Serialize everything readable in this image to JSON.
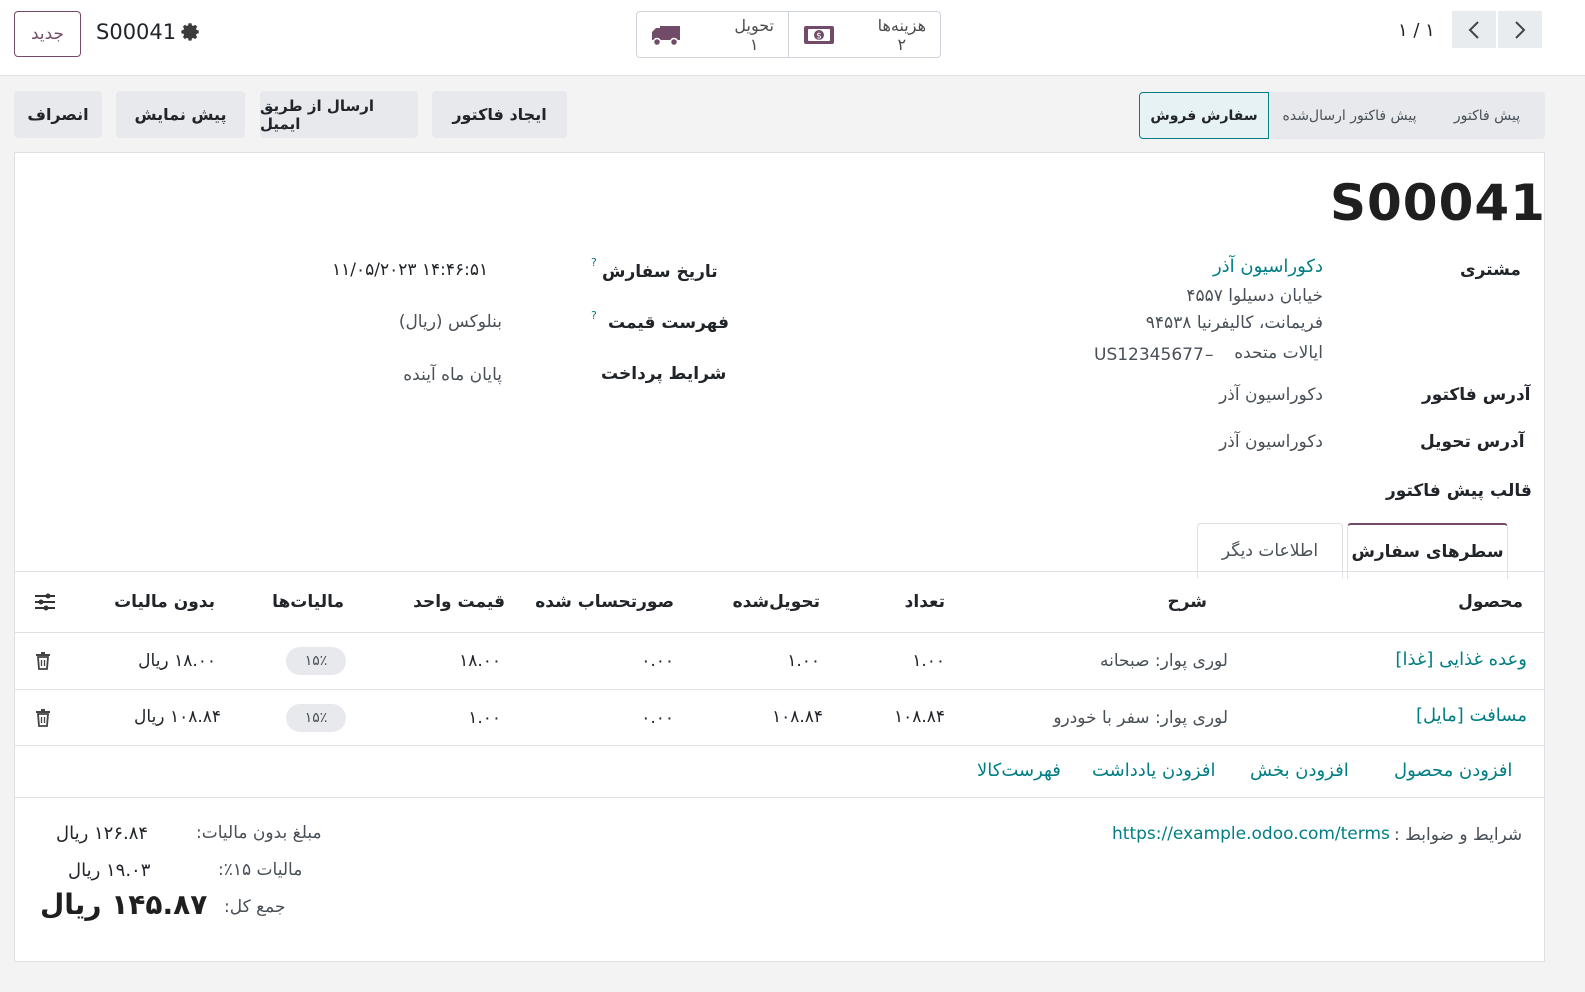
{
  "topbar": {
    "new_label": "جدید",
    "record_name": "S00041",
    "smart_buttons": [
      {
        "label": "هزینه‌ها",
        "count": "۲",
        "icon": "money-icon"
      },
      {
        "label": "تحویل",
        "count": "۱",
        "icon": "truck-icon"
      }
    ],
    "pager": "۱ / ۱"
  },
  "actions": {
    "create_invoice": "ایجاد فاکتور",
    "send_email": "ارسال از طریق ایمیل",
    "preview": "پیش نمایش",
    "cancel": "انصراف"
  },
  "statusbar": {
    "stages": [
      "پیش فاکتور",
      "پیش فاکتور ارسال‌شده",
      "سفارش فروش"
    ],
    "active": "سفارش فروش"
  },
  "form": {
    "title": "S00041",
    "customer_label": "مشتری",
    "customer_name": "دکوراسیون آذر",
    "customer_address_1": "خیابان دسیلوا ۴۵۵۷",
    "customer_address_2": "فریمانت، کالیفرنیا ۹۴۵۳۸",
    "customer_address_3": "ایالات متحده",
    "customer_vat": "US12345677",
    "invoice_address_label": "آدرس فاکتور",
    "invoice_address": "دکوراسیون آذر",
    "delivery_address_label": "آدرس تحویل",
    "delivery_address": "دکوراسیون آذر",
    "template_label": "قالب پیش فاکتور",
    "order_date_label": "تاریخ سفارش",
    "order_date": "۱۱/۰۵/۲۰۲۳ ۱۴:۴۶:۵۱",
    "pricelist_label": "فهرست قیمت",
    "pricelist": "بنلوکس (ریال)",
    "payment_terms_label": "شرایط پرداخت",
    "payment_terms": "پایان ماه آینده",
    "help_mark": "?"
  },
  "tabs": {
    "order_lines": "سطرهای سفارش",
    "other_info": "اطلاعات دیگر"
  },
  "table": {
    "headers": {
      "product": "محصول",
      "description": "شرح",
      "quantity": "تعداد",
      "delivered": "تحویل‌شده",
      "invoiced": "صورتحساب شده",
      "unit_price": "قیمت واحد",
      "taxes": "مالیات‌ها",
      "subtotal": "بدون مالیات"
    },
    "rows": [
      {
        "product": "[غذا] وعده غذایی",
        "description": "لوری پوار: صبحانه",
        "quantity": "۱.۰۰",
        "delivered": "۱.۰۰",
        "invoiced": "۰.۰۰",
        "unit_price": "۱۸.۰۰",
        "tax": "۱۵٪",
        "subtotal": "۱۸.۰۰ ریال"
      },
      {
        "product": "[مایل] مسافت",
        "description": "لوری پوار: سفر با خودرو",
        "quantity": "۱۰۸.۸۴",
        "delivered": "۱۰۸.۸۴",
        "invoiced": "۰.۰۰",
        "unit_price": "۱.۰۰",
        "tax": "۱۵٪",
        "subtotal": "۱۰۸.۸۴ ریال"
      }
    ],
    "add_links": {
      "add_product": "افزودن محصول",
      "add_section": "افزودن بخش",
      "add_note": "افزودن یادداشت",
      "catalog": "فهرست‌کالا"
    }
  },
  "footer": {
    "terms_label": "شرایط و ضوابط :",
    "terms_url": "https://example.odoo.com/terms",
    "untaxed_label": "مبلغ بدون مالیات:",
    "untaxed_value": "۱۲۶.۸۴ ریال",
    "tax_label": "مالیات ۱۵٪:",
    "tax_value": "۱۹.۰۳ ریال",
    "total_label": "جمع کل:",
    "total_value": "۱۴۵.۸۷ ریال"
  },
  "colors": {
    "brand": "#714b67",
    "link": "#017e84"
  }
}
